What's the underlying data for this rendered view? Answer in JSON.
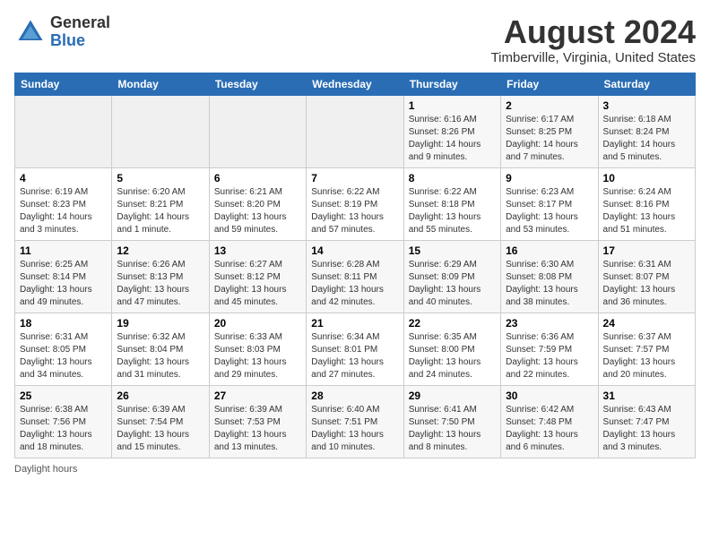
{
  "header": {
    "logo_general": "General",
    "logo_blue": "Blue",
    "title": "August 2024",
    "subtitle": "Timberville, Virginia, United States"
  },
  "calendar": {
    "days_of_week": [
      "Sunday",
      "Monday",
      "Tuesday",
      "Wednesday",
      "Thursday",
      "Friday",
      "Saturday"
    ],
    "weeks": [
      [
        {
          "day": "",
          "info": ""
        },
        {
          "day": "",
          "info": ""
        },
        {
          "day": "",
          "info": ""
        },
        {
          "day": "",
          "info": ""
        },
        {
          "day": "1",
          "info": "Sunrise: 6:16 AM\nSunset: 8:26 PM\nDaylight: 14 hours and 9 minutes."
        },
        {
          "day": "2",
          "info": "Sunrise: 6:17 AM\nSunset: 8:25 PM\nDaylight: 14 hours and 7 minutes."
        },
        {
          "day": "3",
          "info": "Sunrise: 6:18 AM\nSunset: 8:24 PM\nDaylight: 14 hours and 5 minutes."
        }
      ],
      [
        {
          "day": "4",
          "info": "Sunrise: 6:19 AM\nSunset: 8:23 PM\nDaylight: 14 hours and 3 minutes."
        },
        {
          "day": "5",
          "info": "Sunrise: 6:20 AM\nSunset: 8:21 PM\nDaylight: 14 hours and 1 minute."
        },
        {
          "day": "6",
          "info": "Sunrise: 6:21 AM\nSunset: 8:20 PM\nDaylight: 13 hours and 59 minutes."
        },
        {
          "day": "7",
          "info": "Sunrise: 6:22 AM\nSunset: 8:19 PM\nDaylight: 13 hours and 57 minutes."
        },
        {
          "day": "8",
          "info": "Sunrise: 6:22 AM\nSunset: 8:18 PM\nDaylight: 13 hours and 55 minutes."
        },
        {
          "day": "9",
          "info": "Sunrise: 6:23 AM\nSunset: 8:17 PM\nDaylight: 13 hours and 53 minutes."
        },
        {
          "day": "10",
          "info": "Sunrise: 6:24 AM\nSunset: 8:16 PM\nDaylight: 13 hours and 51 minutes."
        }
      ],
      [
        {
          "day": "11",
          "info": "Sunrise: 6:25 AM\nSunset: 8:14 PM\nDaylight: 13 hours and 49 minutes."
        },
        {
          "day": "12",
          "info": "Sunrise: 6:26 AM\nSunset: 8:13 PM\nDaylight: 13 hours and 47 minutes."
        },
        {
          "day": "13",
          "info": "Sunrise: 6:27 AM\nSunset: 8:12 PM\nDaylight: 13 hours and 45 minutes."
        },
        {
          "day": "14",
          "info": "Sunrise: 6:28 AM\nSunset: 8:11 PM\nDaylight: 13 hours and 42 minutes."
        },
        {
          "day": "15",
          "info": "Sunrise: 6:29 AM\nSunset: 8:09 PM\nDaylight: 13 hours and 40 minutes."
        },
        {
          "day": "16",
          "info": "Sunrise: 6:30 AM\nSunset: 8:08 PM\nDaylight: 13 hours and 38 minutes."
        },
        {
          "day": "17",
          "info": "Sunrise: 6:31 AM\nSunset: 8:07 PM\nDaylight: 13 hours and 36 minutes."
        }
      ],
      [
        {
          "day": "18",
          "info": "Sunrise: 6:31 AM\nSunset: 8:05 PM\nDaylight: 13 hours and 34 minutes."
        },
        {
          "day": "19",
          "info": "Sunrise: 6:32 AM\nSunset: 8:04 PM\nDaylight: 13 hours and 31 minutes."
        },
        {
          "day": "20",
          "info": "Sunrise: 6:33 AM\nSunset: 8:03 PM\nDaylight: 13 hours and 29 minutes."
        },
        {
          "day": "21",
          "info": "Sunrise: 6:34 AM\nSunset: 8:01 PM\nDaylight: 13 hours and 27 minutes."
        },
        {
          "day": "22",
          "info": "Sunrise: 6:35 AM\nSunset: 8:00 PM\nDaylight: 13 hours and 24 minutes."
        },
        {
          "day": "23",
          "info": "Sunrise: 6:36 AM\nSunset: 7:59 PM\nDaylight: 13 hours and 22 minutes."
        },
        {
          "day": "24",
          "info": "Sunrise: 6:37 AM\nSunset: 7:57 PM\nDaylight: 13 hours and 20 minutes."
        }
      ],
      [
        {
          "day": "25",
          "info": "Sunrise: 6:38 AM\nSunset: 7:56 PM\nDaylight: 13 hours and 18 minutes."
        },
        {
          "day": "26",
          "info": "Sunrise: 6:39 AM\nSunset: 7:54 PM\nDaylight: 13 hours and 15 minutes."
        },
        {
          "day": "27",
          "info": "Sunrise: 6:39 AM\nSunset: 7:53 PM\nDaylight: 13 hours and 13 minutes."
        },
        {
          "day": "28",
          "info": "Sunrise: 6:40 AM\nSunset: 7:51 PM\nDaylight: 13 hours and 10 minutes."
        },
        {
          "day": "29",
          "info": "Sunrise: 6:41 AM\nSunset: 7:50 PM\nDaylight: 13 hours and 8 minutes."
        },
        {
          "day": "30",
          "info": "Sunrise: 6:42 AM\nSunset: 7:48 PM\nDaylight: 13 hours and 6 minutes."
        },
        {
          "day": "31",
          "info": "Sunrise: 6:43 AM\nSunset: 7:47 PM\nDaylight: 13 hours and 3 minutes."
        }
      ]
    ]
  },
  "footer": {
    "daylight_label": "Daylight hours"
  }
}
